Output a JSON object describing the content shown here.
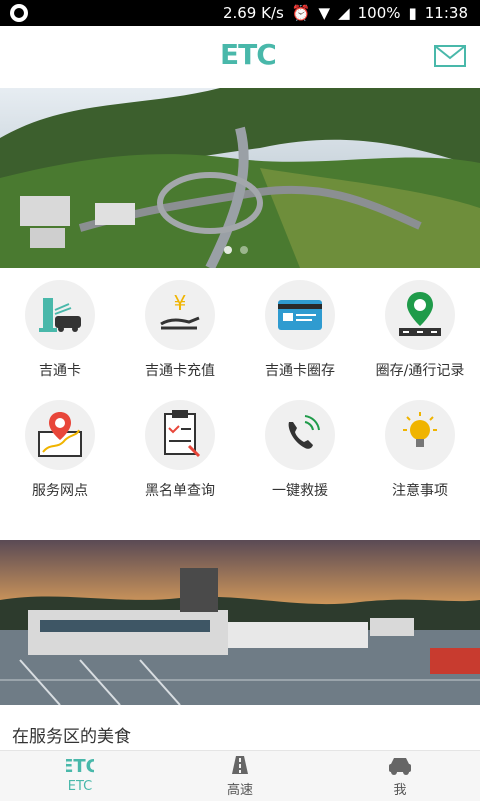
{
  "status_bar": {
    "speed": "2.69 K/s",
    "battery": "100%",
    "time": "11:38"
  },
  "app_bar": {
    "logo_text": "ETC"
  },
  "banner": {
    "description": "",
    "page_count": 2
  },
  "grid": {
    "items": [
      {
        "label": "吉通卡",
        "icon": "card-car-icon"
      },
      {
        "label": "吉通卡充值",
        "icon": "hand-yuan-icon"
      },
      {
        "label": "吉通卡圈存",
        "icon": "card-icon"
      },
      {
        "label": "圈存/通行记录",
        "icon": "location-pin-road-icon"
      },
      {
        "label": "服务网点",
        "icon": "map-pin-icon"
      },
      {
        "label": "黑名单查询",
        "icon": "clipboard-icon"
      },
      {
        "label": "一键救援",
        "icon": "phone-icon"
      },
      {
        "label": "注意事项",
        "icon": "lightbulb-icon"
      }
    ]
  },
  "section": {
    "title": "在服务区的美食"
  },
  "tabs": [
    {
      "label": "ETC",
      "icon": "etc-icon",
      "active": true
    },
    {
      "label": "高速",
      "icon": "road-icon",
      "active": false
    },
    {
      "label": "我",
      "icon": "car-icon",
      "active": false
    }
  ]
}
